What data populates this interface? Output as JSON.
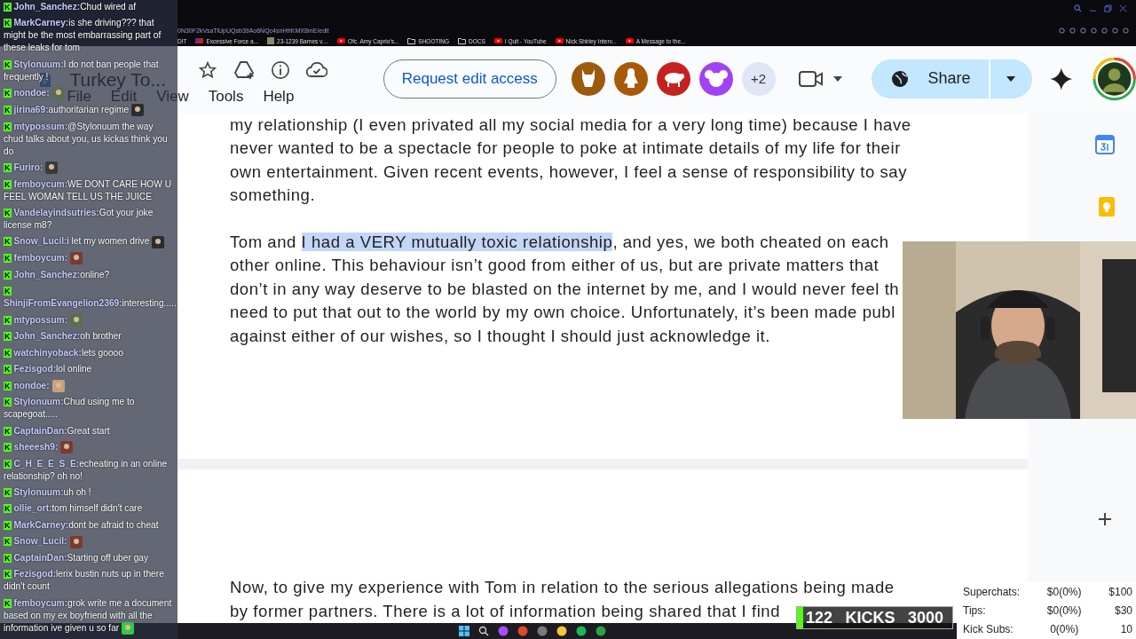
{
  "browser": {
    "url": "0N30F2kVsaTiUpUQsb39Ao6NQc4snHfrKMX8mE/edit",
    "bookmarks": [
      {
        "label": "DIT",
        "kind": "plain"
      },
      {
        "label": "Excessive Force a...",
        "kind": "flag"
      },
      {
        "label": "23-1239 Barnes v....",
        "kind": "thumb"
      },
      {
        "label": "Ofc. Amy Caprio's...",
        "kind": "video"
      },
      {
        "label": "SHOOTING",
        "kind": "folder"
      },
      {
        "label": "DOCS",
        "kind": "folder"
      },
      {
        "label": "I Quit - YouTube",
        "kind": "video"
      },
      {
        "label": "Nick Shirley Interv...",
        "kind": "video"
      },
      {
        "label": "A Message to the...",
        "kind": "video"
      }
    ]
  },
  "docs": {
    "title": "Turkey To...",
    "menu": [
      "File",
      "Edit",
      "View",
      "Tools",
      "Help"
    ],
    "request_button": "Request edit access",
    "collaborators": [
      {
        "kind": "llama",
        "color": "#9c5a0c"
      },
      {
        "kind": "penguin",
        "color": "#a85a08"
      },
      {
        "kind": "sheep",
        "color": "#c5221f"
      },
      {
        "kind": "koala",
        "color": "#a142f4"
      }
    ],
    "more_collaborators": "+2",
    "share_button": "Share"
  },
  "document": {
    "page_1": [
      [
        [
          {
            "text": "my relationship (I even privated all my social media for a very long time) because I have",
            "selected": false
          }
        ],
        [
          {
            "text": "never wanted to be a spectacle for people to poke at intimate details of my life for their",
            "selected": false
          }
        ],
        [
          {
            "text": "own entertainment. Given recent events, however, I feel a sense of responsibility to say",
            "selected": false
          }
        ],
        [
          {
            "text": "something.",
            "selected": false
          }
        ]
      ],
      [
        [
          {
            "text": "Tom and ",
            "selected": false
          },
          {
            "text": "I had a VERY mutually toxic relationship",
            "selected": true
          },
          {
            "text": ", and yes, we both cheated on each",
            "selected": false
          }
        ],
        [
          {
            "text": "other online. This behaviour isn’t good from either of us, but are private matters that",
            "selected": false
          }
        ],
        [
          {
            "text": "don’t in any way deserve to be blasted on the internet by me, and I would never feel th",
            "selected": false
          }
        ],
        [
          {
            "text": "need to put that out to the world by my own choice. Unfortunately, it’s been made publ",
            "selected": false
          }
        ],
        [
          {
            "text": "against either of our wishes, so I thought I should just acknowledge it.",
            "selected": false
          }
        ]
      ]
    ],
    "page_2": [
      [
        {
          "text": "Now, to give my experience with Tom in relation to the serious allegations being made",
          "selected": false
        }
      ],
      [
        {
          "text": "by former partners. There is a lot of information being shared that I find",
          "selected": false
        }
      ]
    ]
  },
  "chat": [
    {
      "badge": "K",
      "user": "John_Sanchez:",
      "text": "Chud wired af"
    },
    {
      "badge": "K",
      "user": "MarkCarney:",
      "text": "is she driving??? that might be the most embarrassing part of these leaks for tom"
    },
    {
      "badge": "K",
      "user": "Stylonuum:",
      "text": "I do not ban people that frequently !"
    },
    {
      "badge": "K",
      "user": "nondoe:",
      "emote": true
    },
    {
      "badge": "K",
      "user": "jirina69:",
      "text": "authoritarian regime",
      "emote": true
    },
    {
      "badge": "K",
      "user": "mtypossum:",
      "text": "@Stylonuum the way chud talks about you, us kickas think you do"
    },
    {
      "badge": "K",
      "user": "Furiro:",
      "emote": true
    },
    {
      "badge": "K",
      "user": "femboycum:",
      "text": "WE DONT CARE HOW U FEEL WOMAN TELL US THE JUICE"
    },
    {
      "badge": "K",
      "user": "Vandelayindsutries:",
      "text": "Got your joke license m8?"
    },
    {
      "badge": "K",
      "user": "Snow_Lucil:",
      "text": "i let my women drive",
      "emote": true
    },
    {
      "badge": "K",
      "user": "femboycum:",
      "emote": true
    },
    {
      "badge": "K",
      "user": "John_Sanchez:",
      "text": "online?"
    },
    {
      "badge": "K",
      "user": "ShinjiFromEvangelion2369:",
      "text": "interesting....."
    },
    {
      "badge": "K",
      "user": "mtypossum:",
      "emote": true
    },
    {
      "badge": "K",
      "user": "John_Sanchez:",
      "text": "oh brother"
    },
    {
      "badge": "K",
      "user": "watchinyoback:",
      "text": "lets goooo"
    },
    {
      "badge": "K",
      "user": "Fezisgod:",
      "text": "lol online"
    },
    {
      "badge": "K",
      "user": "nondoe:",
      "emote": true
    },
    {
      "badge": "K",
      "user": "Stylonuum:",
      "text": "Chud using me to scapegoat....."
    },
    {
      "badge": "K",
      "user": "CaptainDan:",
      "text": "Great start"
    },
    {
      "badge": "K",
      "user": "sheeesh9:",
      "emote": true
    },
    {
      "badge": "K",
      "user": "C_H_E_E_S_E:",
      "text": "echeating in an online relationship? oh no!"
    },
    {
      "badge": "K",
      "user": "Stylonuum:",
      "text": "uh oh !"
    },
    {
      "badge": "K",
      "user": "ollie_ort:",
      "text": "tom himself didn't care"
    },
    {
      "badge": "K",
      "user": "MarkCarney:",
      "text": "dont be afraid to cheat"
    },
    {
      "badge": "K",
      "user": "Snow_Lucil:",
      "emote": true
    },
    {
      "badge": "K",
      "user": "CaptainDan:",
      "text": "Starting off uber gay"
    },
    {
      "badge": "K",
      "user": "Fezisgod:",
      "text": "lerix bustin nuts up in there didn't count"
    },
    {
      "badge": "K",
      "user": "femboycum:",
      "text": "grok write me a document based on my ex boyfriend with all the information ive given u so far",
      "emote": true
    }
  ],
  "goal": {
    "count": "122",
    "label": "KICKS",
    "target": "3000",
    "level": 0.04
  },
  "stats": [
    {
      "label": "Superchats:",
      "value": "$0(0%)",
      "goal": "$100"
    },
    {
      "label": "Tips:",
      "value": "$0(0%)",
      "goal": "$30"
    },
    {
      "label": "Kick Subs:",
      "value": "0(0%)",
      "goal": "10"
    }
  ]
}
